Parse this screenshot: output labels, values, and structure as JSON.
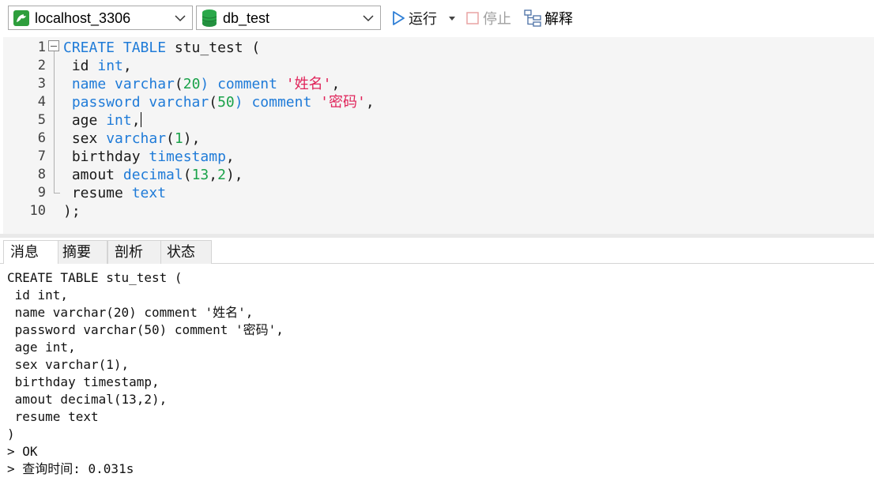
{
  "toolbar": {
    "connection": "localhost_3306",
    "database": "db_test",
    "run_label": "运行",
    "stop_label": "停止",
    "explain_label": "解释"
  },
  "editor": {
    "line_numbers": [
      "1",
      "2",
      "3",
      "4",
      "5",
      "6",
      "7",
      "8",
      "9",
      "10"
    ],
    "l1": {
      "t1": "CREATE TABLE",
      "t2": " stu_test ("
    },
    "l2": {
      "t1": " id ",
      "t2": "int",
      "t3": ","
    },
    "l3": {
      "t1": " name varchar",
      "t2": "(",
      "t3": "20",
      "t4": ") comment ",
      "t5": "'姓名'",
      "t6": ","
    },
    "l4": {
      "t1": " password varchar",
      "t2": "(",
      "t3": "50",
      "t4": ") comment ",
      "t5": "'密码'",
      "t6": ","
    },
    "l5": {
      "t1": " age ",
      "t2": "int",
      "t3": ","
    },
    "l6": {
      "t1": " sex ",
      "t2": "varchar",
      "t3": "(",
      "t4": "1",
      "t5": "),"
    },
    "l7": {
      "t1": " birthday ",
      "t2": "timestamp",
      "t3": ","
    },
    "l8": {
      "t1": " amout ",
      "t2": "decimal",
      "t3": "(",
      "t4": "13",
      "t5": ",",
      "t6": "2",
      "t7": "),"
    },
    "l9": {
      "t1": " resume ",
      "t2": "text"
    },
    "l10": {
      "t1": ");"
    }
  },
  "tabs": [
    "消息",
    "摘要",
    "剖析",
    "状态"
  ],
  "output_lines": [
    "CREATE TABLE stu_test (",
    " id int,",
    " name varchar(20) comment '姓名',",
    " password varchar(50) comment '密码',",
    " age int,",
    " sex varchar(1),",
    " birthday timestamp,",
    " amout decimal(13,2),",
    " resume text",
    ")",
    "> OK",
    "> 查询时间: 0.031s"
  ]
}
